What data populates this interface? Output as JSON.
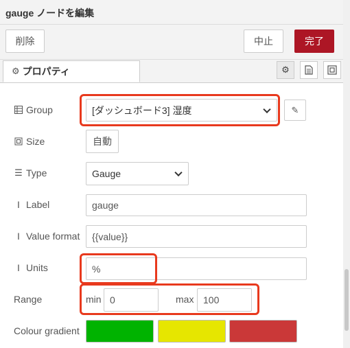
{
  "header": {
    "title": "gauge ノードを編集"
  },
  "toolbar": {
    "delete_label": "削除",
    "cancel_label": "中止",
    "done_label": "完了"
  },
  "tabs": {
    "properties_label": "プロパティ"
  },
  "form": {
    "group": {
      "label": "Group",
      "value": "[ダッシュボード3] 湿度"
    },
    "size": {
      "label": "Size",
      "value": "自動"
    },
    "type": {
      "label": "Type",
      "value": "Gauge"
    },
    "label": {
      "label": "Label",
      "value": "gauge"
    },
    "value_format": {
      "label": "Value format",
      "value": "{{value}}"
    },
    "units": {
      "label": "Units",
      "value": "%"
    },
    "range": {
      "label": "Range",
      "min_label": "min",
      "min_value": "0",
      "max_label": "max",
      "max_value": "100"
    },
    "colour_gradient": {
      "label": "Colour gradient",
      "colors": [
        "#00b300",
        "#e6e600",
        "#ca3838"
      ]
    }
  },
  "colors": {
    "accent": "#ad1625",
    "highlight": "#e8391d"
  }
}
